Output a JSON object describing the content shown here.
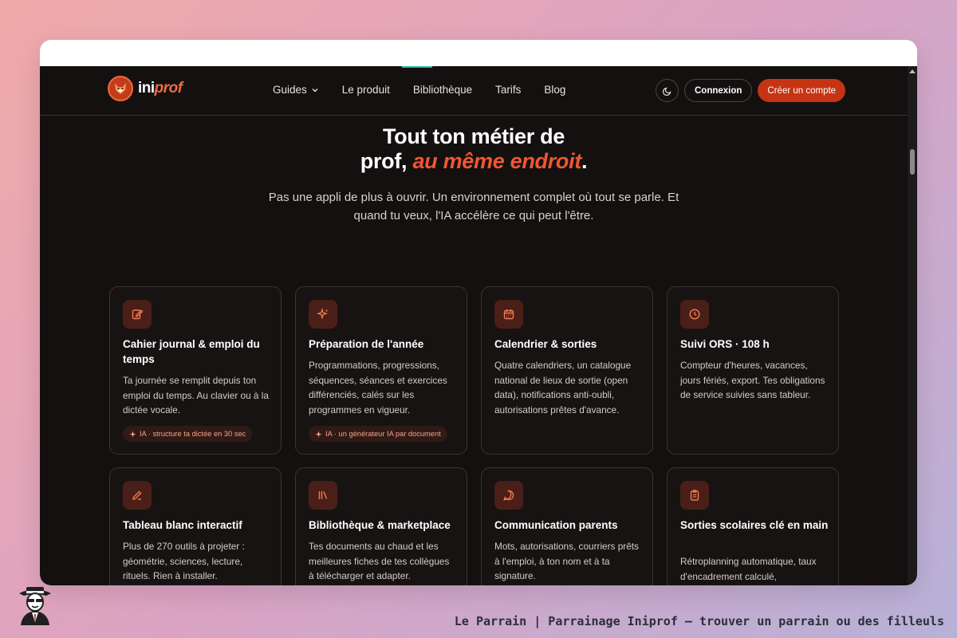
{
  "brand": {
    "name_plain": "ini",
    "name_accent": "prof"
  },
  "nav": {
    "links": [
      {
        "label": "Guides"
      },
      {
        "label": "Le produit"
      },
      {
        "label": "Bibliothèque"
      },
      {
        "label": "Tarifs"
      },
      {
        "label": "Blog"
      }
    ],
    "login_label": "Connexion",
    "signup_label": "Créer un compte"
  },
  "hero": {
    "title_line1": "Tout ton métier de",
    "title_line2_plain": "prof,",
    "title_line2_accent": "au même endroit",
    "title_line2_end": ".",
    "subtitle": "Pas une appli de plus à ouvrir. Un environnement complet où tout se parle. Et quand tu veux, l'IA accélère ce qui peut l'être."
  },
  "cards": [
    {
      "icon": "notebook-edit-icon",
      "title": "Cahier journal & emploi du temps",
      "desc": "Ta journée se remplit depuis ton emploi du temps. Au clavier ou à la dictée vocale.",
      "tag": "IA · structure ta dictée en 30 sec"
    },
    {
      "icon": "sparkles-icon",
      "title": "Préparation de l'année",
      "desc": "Programmations, progressions, séquences, séances et exercices différenciés, calés sur les programmes en vigueur.",
      "tag": "IA · un générateur IA par document"
    },
    {
      "icon": "calendar-icon",
      "title": "Calendrier & sorties",
      "desc": "Quatre calendriers, un catalogue national de lieux de sortie (open data), notifications anti-oubli, autorisations prêtes d'avance.",
      "tag": ""
    },
    {
      "icon": "clock-icon",
      "title": "Suivi ORS · 108 h",
      "desc": "Compteur d'heures, vacances, jours fériés, export. Tes obligations de service suivies sans tableur.",
      "tag": ""
    },
    {
      "icon": "pencil-icon",
      "title": "Tableau blanc interactif",
      "desc": "Plus de 270 outils à projeter : géométrie, sciences, lecture, rituels. Rien à installer.",
      "tag": ""
    },
    {
      "icon": "library-icon",
      "title": "Bibliothèque & marketplace",
      "desc": "Tes documents au chaud et les meilleures fiches de tes collègues à télécharger et adapter.",
      "tag": ""
    },
    {
      "icon": "message-circle-icon",
      "title": "Communication parents",
      "desc": "Mots, autorisations, courriers prêts à l'emploi, à ton nom et à ta signature.",
      "tag": ""
    },
    {
      "icon": "clipboard-icon",
      "title": "Sorties scolaires clé en main",
      "desc": "Rétroplanning automatique, taux d'encadrement calculé,",
      "tag": ""
    }
  ],
  "footer": {
    "caption": "Le Parrain | Parrainage Iniprof — trouver un parrain ou des filleuls"
  },
  "colors": {
    "accent": "#f0572f",
    "button": "#c73413",
    "page_bg": "#141010"
  }
}
